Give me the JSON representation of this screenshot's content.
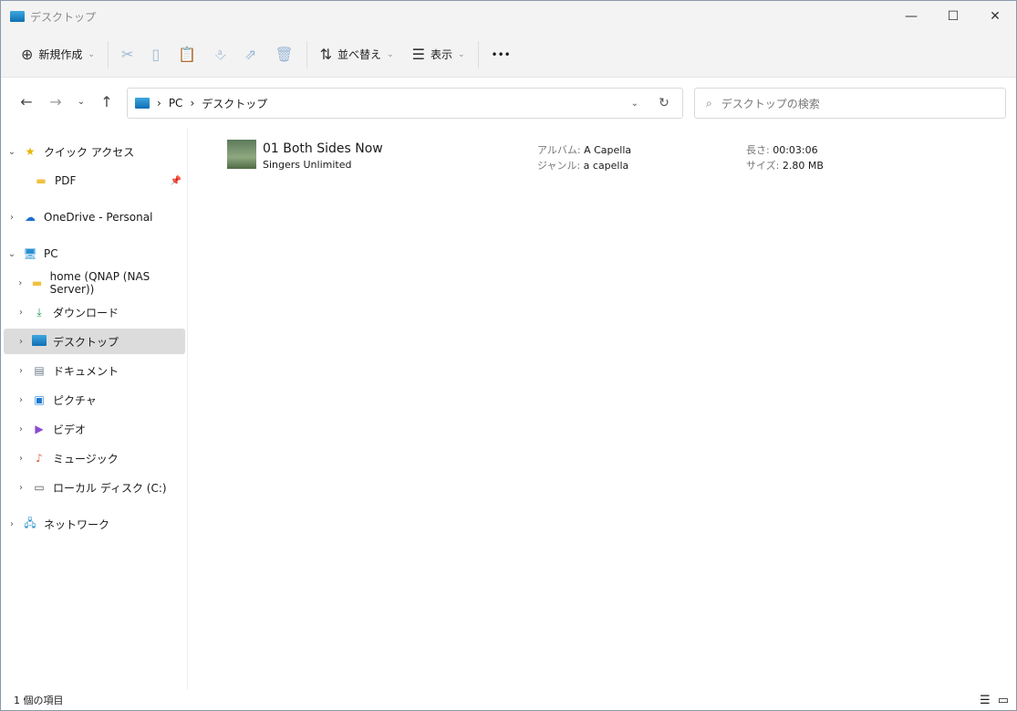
{
  "window": {
    "title": "デスクトップ"
  },
  "toolbar": {
    "new": "新規作成",
    "sort": "並べ替え",
    "view": "表示",
    "more": "•••"
  },
  "nav": {
    "breadcrumb": [
      "PC",
      "デスクトップ"
    ],
    "search_placeholder": "デスクトップの検索"
  },
  "sidebar": {
    "items": [
      "クイック アクセス",
      "PDF",
      "OneDrive - Personal",
      "PC",
      "home (QNAP (NAS Server))",
      "ダウンロード",
      "デスクトップ",
      "ドキュメント",
      "ピクチャ",
      "ビデオ",
      "ミュージック",
      "ローカル ディスク (C:)",
      "ネットワーク"
    ]
  },
  "file": {
    "name": "01 Both Sides Now",
    "artist": "Singers Unlimited",
    "album_label": "アルバム:",
    "album": "A Capella",
    "genre_label": "ジャンル:",
    "genre": "a capella",
    "length_label": "長さ:",
    "length": "00:03:06",
    "size_label": "サイズ:",
    "size": "2.80 MB"
  },
  "status": {
    "count": "1 個の項目"
  }
}
